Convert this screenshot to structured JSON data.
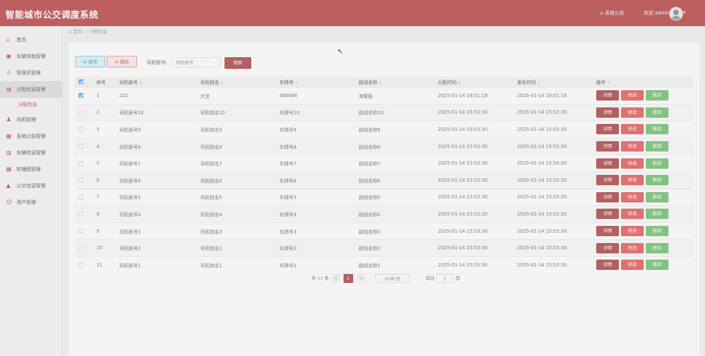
{
  "app": {
    "title": "智能城市公交调度系统"
  },
  "header": {
    "notice": "系统公告",
    "welcome": "欢迎 admin",
    "caret": "▾"
  },
  "sidebar": {
    "items": [
      {
        "label": "首页",
        "icon": "home-icon"
      },
      {
        "label": "车辆求助管理",
        "icon": "bus-icon"
      },
      {
        "label": "管理员管理",
        "icon": "user-icon"
      },
      {
        "label": "分配信息管理",
        "icon": "folder-icon",
        "active": true
      },
      {
        "label": "司机管理",
        "icon": "driver-icon"
      },
      {
        "label": "系统公告管理",
        "icon": "notice-icon"
      },
      {
        "label": "车辆信息管理",
        "icon": "car-icon"
      },
      {
        "label": "轮播图管理",
        "icon": "carousel-icon"
      },
      {
        "label": "公交信息管理",
        "icon": "info-icon"
      },
      {
        "label": "用户管理",
        "icon": "people-icon"
      }
    ],
    "sub_item": "分配信息"
  },
  "breadcrumb": {
    "home": "首页",
    "sep": "—",
    "current": "分配信息"
  },
  "toolbar": {
    "add_label": "新增",
    "delete_label": "删除",
    "filter_label": "司机账号:",
    "filter_placeholder": "司机账号",
    "search_label": "搜索"
  },
  "table": {
    "columns": [
      "序号",
      "司机账号",
      "司机姓名",
      "车牌号",
      "路线名称",
      "分配时间",
      "发车时间",
      "操作"
    ],
    "rows": [
      {
        "no": "1",
        "account": "222",
        "name": "大宝",
        "plate": "666666",
        "route": "海棠路",
        "assign_time": "2025-01-14 16:01:18",
        "depart_time": "2025-01-14 16:01:18",
        "checked": true
      },
      {
        "no": "2",
        "account": "司机账号10",
        "name": "司机姓名10",
        "plate": "车牌号10",
        "route": "路线名称10",
        "assign_time": "2025-01-14 15:53:30",
        "depart_time": "2025-01-14 15:53:30"
      },
      {
        "no": "3",
        "account": "司机账号9",
        "name": "司机姓名9",
        "plate": "车牌号9",
        "route": "路线名称9",
        "assign_time": "2025-01-14 15:53:30",
        "depart_time": "2025-01-14 15:53:30"
      },
      {
        "no": "4",
        "account": "司机账号8",
        "name": "司机姓名8",
        "plate": "车牌号8",
        "route": "路线名称8",
        "assign_time": "2025-01-14 15:53:30",
        "depart_time": "2025-01-14 15:53:30"
      },
      {
        "no": "5",
        "account": "司机账号7",
        "name": "司机姓名7",
        "plate": "车牌号7",
        "route": "路线名称7",
        "assign_time": "2025-01-14 15:53:30",
        "depart_time": "2025-01-14 15:53:30"
      },
      {
        "no": "6",
        "account": "司机账号6",
        "name": "司机姓名6",
        "plate": "车牌号6",
        "route": "路线名称6",
        "assign_time": "2025-01-14 15:53:30",
        "depart_time": "2025-01-14 15:53:30"
      },
      {
        "no": "7",
        "account": "司机账号5",
        "name": "司机姓名5",
        "plate": "车牌号5",
        "route": "路线名称5",
        "assign_time": "2025-01-14 15:53:30",
        "depart_time": "2025-01-14 15:53:30"
      },
      {
        "no": "8",
        "account": "司机账号4",
        "name": "司机姓名4",
        "plate": "车牌号4",
        "route": "路线名称4",
        "assign_time": "2025-01-14 15:53:30",
        "depart_time": "2025-01-14 15:53:30"
      },
      {
        "no": "9",
        "account": "司机账号3",
        "name": "司机姓名3",
        "plate": "车牌号3",
        "route": "路线名称3",
        "assign_time": "2025-01-14 15:53:30",
        "depart_time": "2025-01-14 15:53:30"
      },
      {
        "no": "10",
        "account": "司机账号2",
        "name": "司机姓名2",
        "plate": "车牌号2",
        "route": "路线名称2",
        "assign_time": "2025-01-14 15:53:30",
        "depart_time": "2025-01-14 15:53:30"
      },
      {
        "no": "11",
        "account": "司机账号1",
        "name": "司机姓名1",
        "plate": "车牌号1",
        "route": "路线名称1",
        "assign_time": "2025-01-14 15:53:30",
        "depart_time": "2025-01-14 15:53:30"
      }
    ],
    "actions": {
      "detail": "详情",
      "edit": "修改",
      "delete": "删除"
    }
  },
  "pagination": {
    "total": "共 11 条",
    "prev": "<",
    "current": "1",
    "next": ">",
    "page_size": "20条/页",
    "goto": "前往",
    "goto_value": "1",
    "unit": "页"
  },
  "colors": {
    "brand": "#b02a2a",
    "detail": "#a32b2b",
    "edit": "#e04646",
    "delete": "#5cb85c"
  }
}
